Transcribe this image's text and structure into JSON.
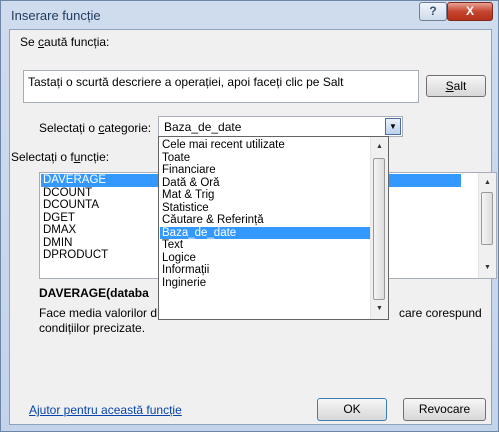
{
  "window": {
    "title": "Inserare funcție",
    "help_label": "?",
    "close_label": "X"
  },
  "search": {
    "label_pre": "Se ",
    "label_u": "c",
    "label_post": "aută funcția:",
    "value": "Tastați o scurtă descriere a operației, apoi faceți clic pe Salt",
    "go_u": "S",
    "go_post": "alt"
  },
  "category": {
    "label_pre": "Selectați o ",
    "label_u": "c",
    "label_post": "ategorie:",
    "value": "Baza_de_date",
    "options": [
      "Cele mai recent utilizate",
      "Toate",
      "Financiare",
      "Dată & Oră",
      "Mat & Trig",
      "Statistice",
      "Căutare & Referință",
      "Baza_de_date",
      "Text",
      "Logice",
      "Informații",
      "Inginerie"
    ],
    "selected_index": 7
  },
  "functions": {
    "label_pre": "Selectați o f",
    "label_u": "u",
    "label_post": "ncție:",
    "items": [
      "DAVERAGE",
      "DCOUNT",
      "DCOUNTA",
      "DGET",
      "DMAX",
      "DMIN",
      "DPRODUCT"
    ],
    "selected_index": 0
  },
  "description": {
    "signature": "DAVERAGE(databa",
    "line1_left": "Face media valorilor d",
    "line1_right": "care corespund",
    "line2": "condițiilor precizate."
  },
  "footer": {
    "help_link": "Ajutor pentru această funcție",
    "ok_label": "OK",
    "cancel_label": "Revocare"
  }
}
